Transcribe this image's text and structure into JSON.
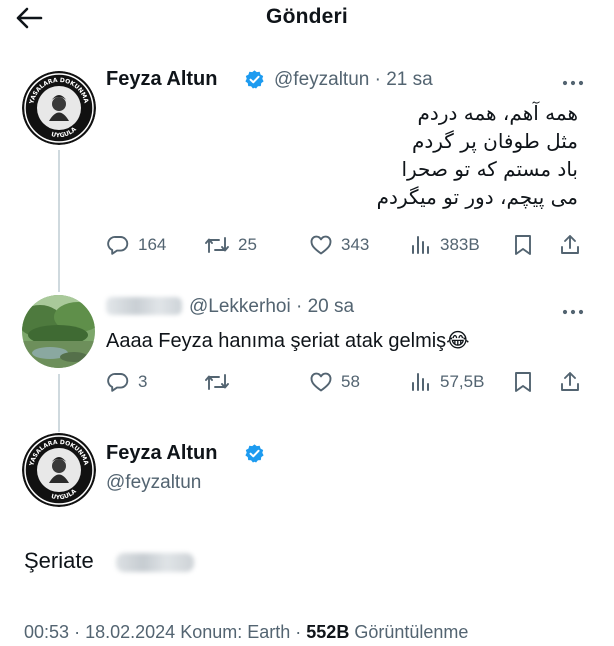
{
  "header": {
    "title": "Gönderi"
  },
  "colors": {
    "verified": "#1d9bf0",
    "muted": "#536471",
    "text": "#0f1419",
    "thread_line": "#cfd9de"
  },
  "tweet1": {
    "name": "Feyza Altun",
    "handle": "@feyzaltun",
    "sep": "·",
    "time": "21 sa",
    "avatar_text": "YASALARA DOKUNMA UYGULA",
    "lines": [
      "همه آهم، همه دردم",
      "مثل طوفان پر گردم",
      "باد مستم که تو صحرا",
      "می پیچم، دور تو میگردم"
    ],
    "stats": {
      "replies": "164",
      "reposts": "25",
      "likes": "343",
      "views": "383B"
    }
  },
  "tweet2": {
    "handle": "@Lekkerhoi",
    "sep": "·",
    "time": "20 sa",
    "text": "Aaaa Feyza hanıma şeriat atak gelmiş",
    "emoji": "😂",
    "stats": {
      "replies": "3",
      "likes": "58",
      "views": "57,5B"
    }
  },
  "main": {
    "name": "Feyza Altun",
    "handle": "@feyzaltun",
    "avatar_text": "YASALARA DOKUNMA UYGULA",
    "text": "Şeriate",
    "time": "00:53",
    "date": "18.02.2024",
    "location": "Konum: Earth",
    "views": "552B",
    "views_label": "Görüntülenme",
    "sep": "·"
  },
  "icons": [
    "back-arrow-icon",
    "verified-badge-icon",
    "more-icon",
    "reply-icon",
    "repost-icon",
    "like-icon",
    "views-icon",
    "bookmark-icon",
    "share-icon"
  ]
}
